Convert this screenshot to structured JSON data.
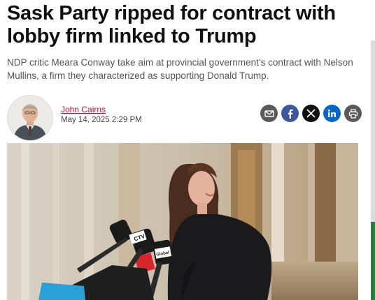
{
  "article": {
    "headline": "Sask Party ripped for contract with lobby firm linked to Trump",
    "dek": "NDP critic Meara Conway take aim at provincial government’s contract with Nelson Mullins, a firm they characterized as supporting Donald Trump.",
    "author": "John Cairns",
    "date": "May 14, 2025 2:29 PM"
  },
  "share": [
    {
      "icon": "email-icon",
      "color": "#5a5a5a"
    },
    {
      "icon": "facebook-icon",
      "color": "#3b5998"
    },
    {
      "icon": "x-icon",
      "color": "#111111"
    },
    {
      "icon": "linkedin-icon",
      "color": "#0a66c2"
    },
    {
      "icon": "print-icon",
      "color": "#5a5a5a"
    }
  ],
  "hero_image": {
    "mic_labels": [
      "CTV",
      "Global news"
    ]
  }
}
